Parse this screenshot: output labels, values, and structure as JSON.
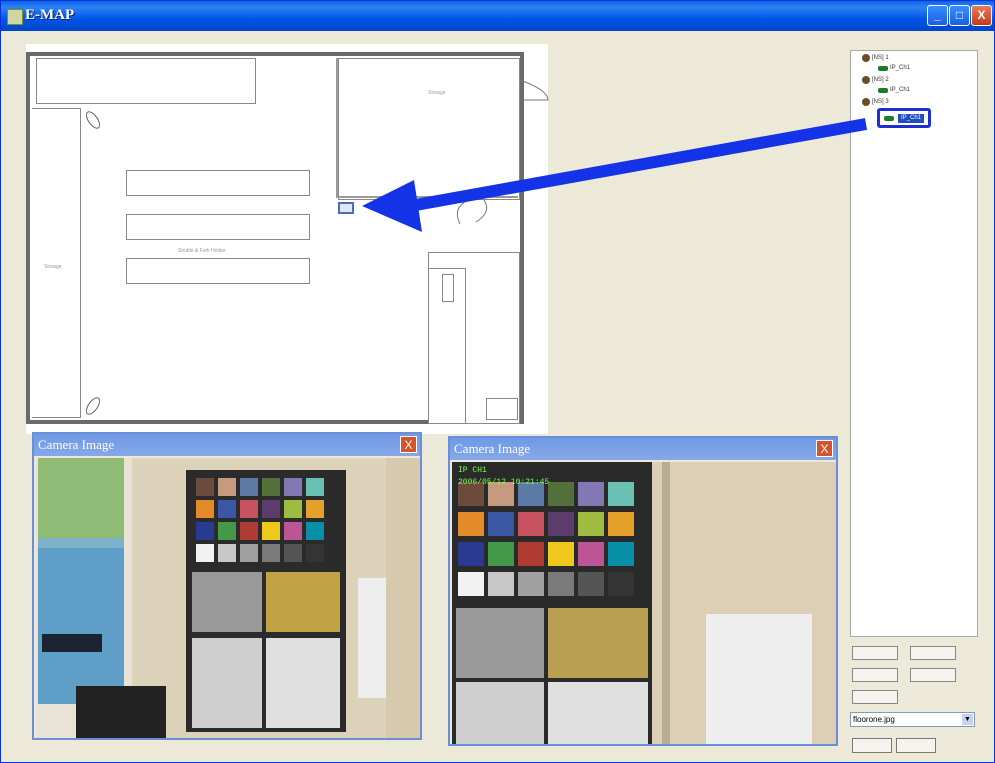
{
  "window": {
    "title": "E-MAP"
  },
  "titlebar_buttons": {
    "minimize": "_",
    "maximize": "□",
    "close": "X"
  },
  "floorplan": {
    "room_labels": [
      "Storage",
      "Storage",
      "Shuttle & Fork Holder"
    ]
  },
  "tree": {
    "items": [
      {
        "type": "node",
        "label": "[NS] 1"
      },
      {
        "type": "camera",
        "label": "IP_Ch1"
      },
      {
        "type": "node",
        "label": "[NS] 2"
      },
      {
        "type": "camera",
        "label": "IP_Ch1"
      },
      {
        "type": "node",
        "label": "[NS] 3"
      },
      {
        "type": "camera",
        "label": "IP_Ch1"
      }
    ],
    "selected_label": "IP_Ch1"
  },
  "controls": {
    "select_value": "floorone.jpg",
    "select_arrow": "▼"
  },
  "camera_windows": [
    {
      "title": "Camera Image",
      "close": "X"
    },
    {
      "title": "Camera Image",
      "close": "X",
      "overlay_line1": "IP CH1",
      "overlay_line2": "2006/05/12 10:21:45"
    }
  ],
  "colors": {
    "title_bar": "#0055E5",
    "arrow": "#1432E6",
    "camera_titlebar": "#7FA3E8",
    "close_button": "#D2552C"
  }
}
